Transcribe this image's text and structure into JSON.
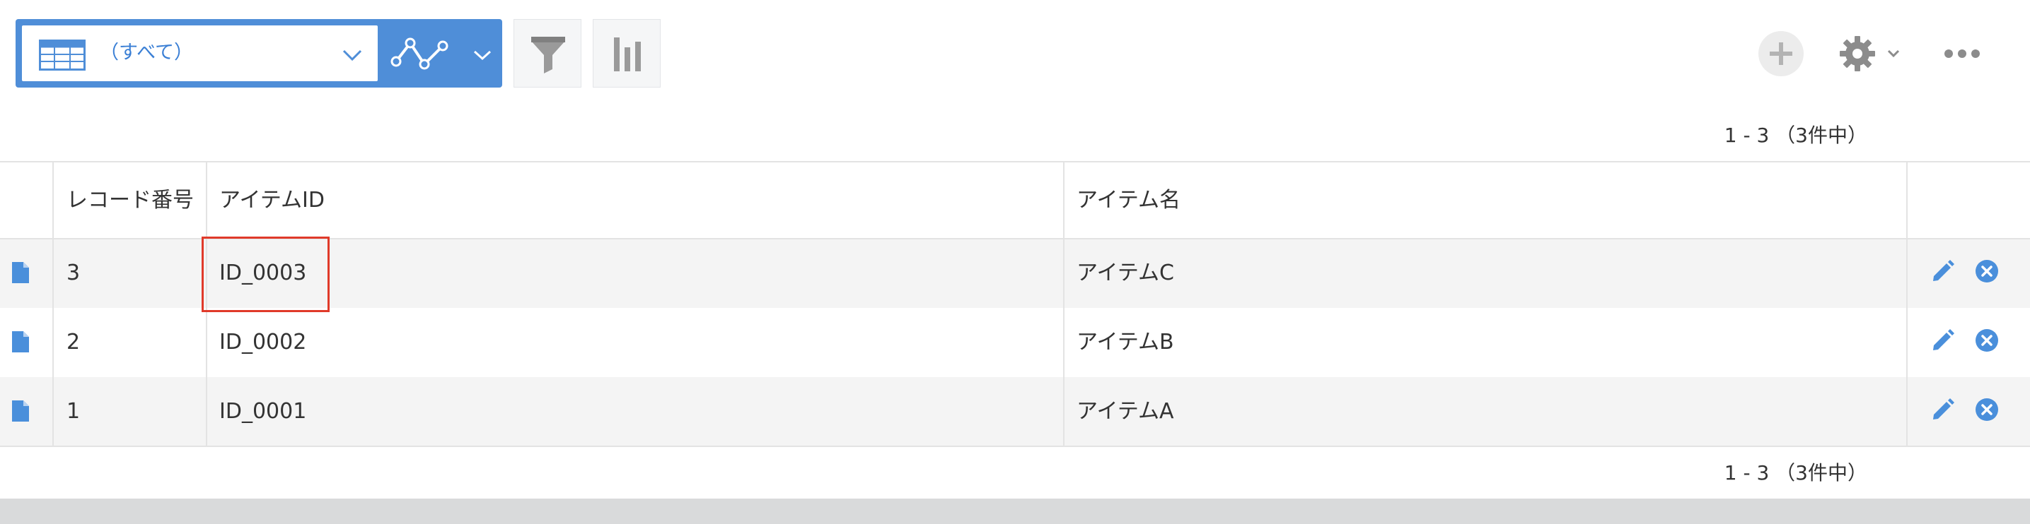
{
  "toolbar": {
    "view_name": "（すべて）",
    "view_icon": "table-grid-icon",
    "graph_icon": "line-graph-icon",
    "filter_icon": "funnel-icon",
    "chart_icon": "bar-chart-icon",
    "add_icon": "plus-icon",
    "settings_icon": "gear-icon",
    "more_icon": "ellipsis-icon"
  },
  "pager": {
    "top": "1 - 3 （3件中）",
    "bottom": "1 - 3 （3件中）"
  },
  "table": {
    "columns": [
      "レコード番号",
      "アイテムID",
      "アイテム名"
    ],
    "rows": [
      {
        "record_no": "3",
        "item_id": "ID_0003",
        "item_name": "アイテムC"
      },
      {
        "record_no": "2",
        "item_id": "ID_0002",
        "item_name": "アイテムB"
      },
      {
        "record_no": "1",
        "item_id": "ID_0001",
        "item_name": "アイテムA"
      }
    ]
  },
  "colors": {
    "accent": "#4f8ed8",
    "highlight": "#e03a2a",
    "row_alt": "#f4f4f4"
  }
}
